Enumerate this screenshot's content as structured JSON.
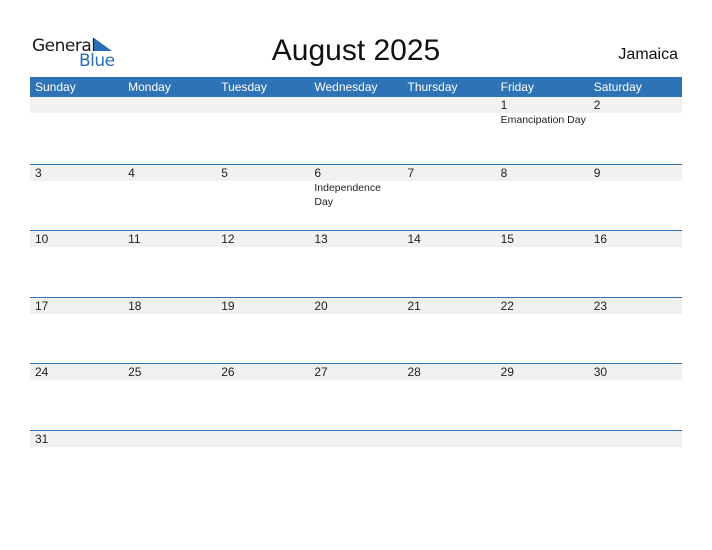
{
  "logo": {
    "general": "General",
    "blue": "Blue"
  },
  "title": "August 2025",
  "country": "Jamaica",
  "weekdays": [
    "Sunday",
    "Monday",
    "Tuesday",
    "Wednesday",
    "Thursday",
    "Friday",
    "Saturday"
  ],
  "weeks": [
    [
      {
        "day": "",
        "holiday": ""
      },
      {
        "day": "",
        "holiday": ""
      },
      {
        "day": "",
        "holiday": ""
      },
      {
        "day": "",
        "holiday": ""
      },
      {
        "day": "",
        "holiday": ""
      },
      {
        "day": "1",
        "holiday": "Emancipation Day"
      },
      {
        "day": "2",
        "holiday": ""
      }
    ],
    [
      {
        "day": "3",
        "holiday": ""
      },
      {
        "day": "4",
        "holiday": ""
      },
      {
        "day": "5",
        "holiday": ""
      },
      {
        "day": "6",
        "holiday": "Independence Day"
      },
      {
        "day": "7",
        "holiday": ""
      },
      {
        "day": "8",
        "holiday": ""
      },
      {
        "day": "9",
        "holiday": ""
      }
    ],
    [
      {
        "day": "10",
        "holiday": ""
      },
      {
        "day": "11",
        "holiday": ""
      },
      {
        "day": "12",
        "holiday": ""
      },
      {
        "day": "13",
        "holiday": ""
      },
      {
        "day": "14",
        "holiday": ""
      },
      {
        "day": "15",
        "holiday": ""
      },
      {
        "day": "16",
        "holiday": ""
      }
    ],
    [
      {
        "day": "17",
        "holiday": ""
      },
      {
        "day": "18",
        "holiday": ""
      },
      {
        "day": "19",
        "holiday": ""
      },
      {
        "day": "20",
        "holiday": ""
      },
      {
        "day": "21",
        "holiday": ""
      },
      {
        "day": "22",
        "holiday": ""
      },
      {
        "day": "23",
        "holiday": ""
      }
    ],
    [
      {
        "day": "24",
        "holiday": ""
      },
      {
        "day": "25",
        "holiday": ""
      },
      {
        "day": "26",
        "holiday": ""
      },
      {
        "day": "27",
        "holiday": ""
      },
      {
        "day": "28",
        "holiday": ""
      },
      {
        "day": "29",
        "holiday": ""
      },
      {
        "day": "30",
        "holiday": ""
      }
    ],
    [
      {
        "day": "31",
        "holiday": ""
      },
      {
        "day": "",
        "holiday": ""
      },
      {
        "day": "",
        "holiday": ""
      },
      {
        "day": "",
        "holiday": ""
      },
      {
        "day": "",
        "holiday": ""
      },
      {
        "day": "",
        "holiday": ""
      },
      {
        "day": "",
        "holiday": ""
      }
    ]
  ]
}
